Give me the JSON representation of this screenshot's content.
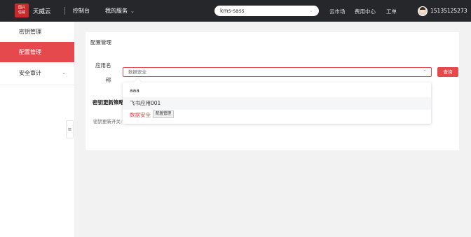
{
  "topbar": {
    "logo_text": "国兴信威",
    "brand": "天威云",
    "console": "控制台",
    "services": "我的服务",
    "env_value": "kms-sass",
    "links": [
      "云市场",
      "费用中心",
      "工单"
    ],
    "username": "15135125273"
  },
  "sidebar": {
    "items": [
      {
        "label": "密钥管理"
      },
      {
        "label": "配置管理"
      },
      {
        "label": "安全审计"
      }
    ]
  },
  "main": {
    "card_title": "配置管理",
    "app_label_line1": "应用名",
    "app_label_line2": "称",
    "app_select_value": "数据安全",
    "query_button": "查询",
    "section_heading": "密钥更新策略",
    "switch_label": "密钥更新开关:"
  },
  "dropdown": {
    "options": [
      {
        "label": "aaa"
      },
      {
        "label": "飞书应用001"
      },
      {
        "label": "数据安全"
      }
    ],
    "tooltip": "配置管理"
  }
}
